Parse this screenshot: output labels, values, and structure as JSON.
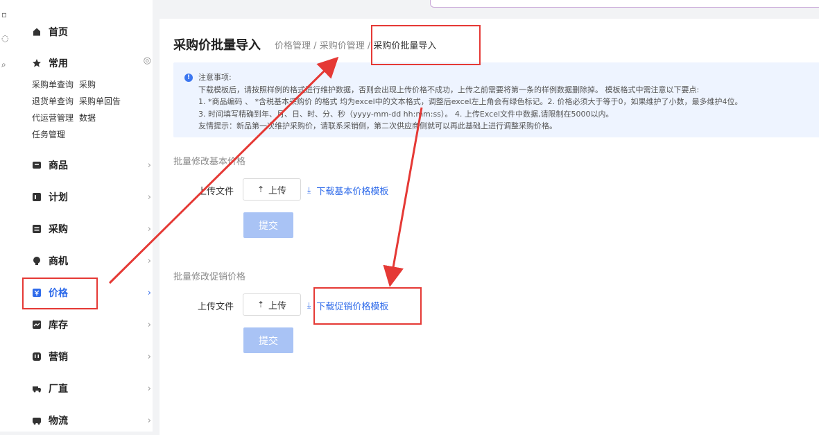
{
  "sidebar": {
    "home": "首页",
    "common": "常用",
    "quick_links": [
      [
        "采购单查询",
        "采购"
      ],
      [
        "退货单查询",
        "采购单回告"
      ],
      [
        "代运营管理",
        "数据"
      ],
      [
        "任务管理",
        ""
      ]
    ],
    "items": [
      "商品",
      "计划",
      "采购",
      "商机",
      "价格",
      "库存",
      "营销",
      "厂直",
      "物流"
    ],
    "active_item": "价格"
  },
  "page": {
    "title": "采购价批量导入",
    "breadcrumb": [
      "价格管理",
      "采购价管理",
      "采购价批量导入"
    ],
    "breadcrumb_sep": "/"
  },
  "notice": {
    "heading": "注意事项:",
    "lines": [
      "下载模板后，请按照样例的格式进行维护数据，否则会出现上传价格不成功，上传之前需要将第一条的样例数据删除掉。 模板格式中需注意以下要点:",
      "1. *商品编码 、 *含税基本采购价 的格式 均为excel中的文本格式，调整后excel左上角会有绿色标记。2. 价格必须大于等于0，如果维护了小数，最多维护4位。",
      "3. 时间填写精确到年、月、日、时、分、秒（yyyy-mm-dd hh:mm:ss）。 4. 上传Excel文件中数据,请限制在5000以内。",
      "友情提示：新品第一次维护采购价，请联系采销侧，第二次供应商侧就可以再此基础上进行调整采购价格。"
    ]
  },
  "section_basic": {
    "title": "批量修改基本价格",
    "file_label": "上传文件",
    "upload": "上传",
    "download": "下载基本价格模板",
    "submit": "提交"
  },
  "section_promo": {
    "title": "批量修改促销价格",
    "file_label": "上传文件",
    "upload": "上传",
    "download": "下载促销价格模板",
    "submit": "提交"
  },
  "colors": {
    "accent": "#2f6bea",
    "annotation": "#e53935",
    "notice_bg": "#eef4ff",
    "submit_disabled": "#a9c3f5"
  }
}
